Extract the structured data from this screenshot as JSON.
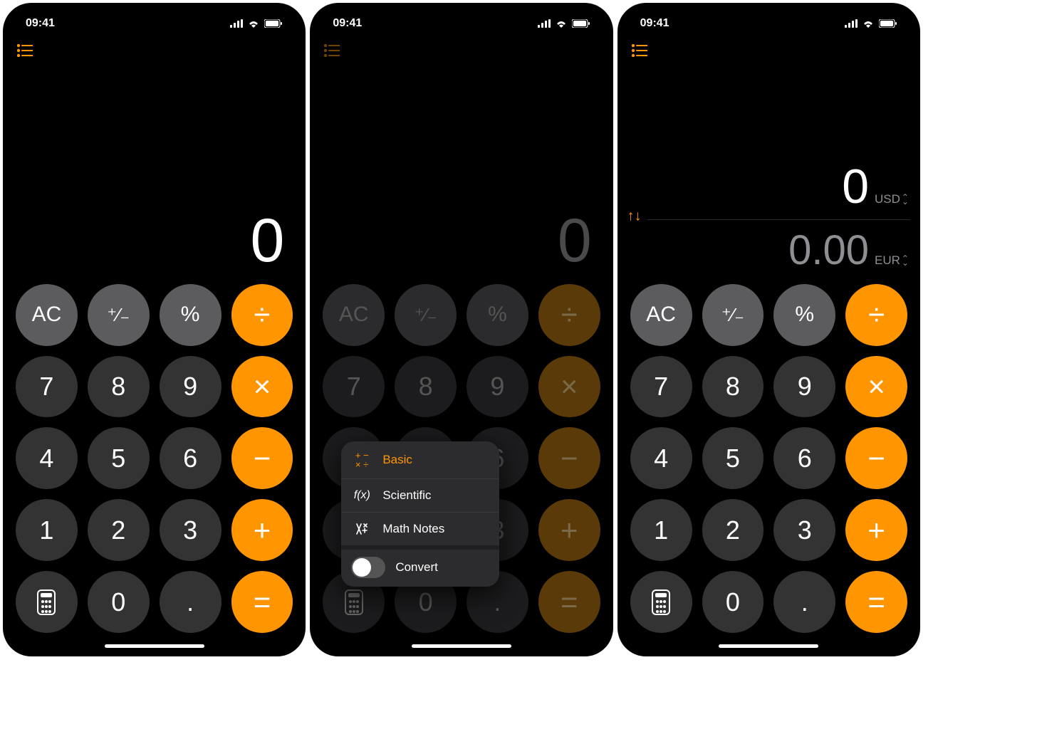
{
  "status": {
    "time": "09:41"
  },
  "screen1": {
    "display": "0"
  },
  "screen2": {
    "display": "0",
    "menu": {
      "basic": "Basic",
      "scientific": "Scientific",
      "mathnotes": "Math Notes",
      "convert": "Convert"
    }
  },
  "screen3": {
    "from_value": "0",
    "from_currency": "USD",
    "to_value": "0.00",
    "to_currency": "EUR"
  },
  "keys": {
    "ac": "AC",
    "plusminus": "⁺⁄₋",
    "percent": "%",
    "divide": "÷",
    "multiply": "×",
    "minus": "−",
    "plus": "+",
    "equals": "=",
    "decimal": ".",
    "d0": "0",
    "d1": "1",
    "d2": "2",
    "d3": "3",
    "d4": "4",
    "d5": "5",
    "d6": "6",
    "d7": "7",
    "d8": "8",
    "d9": "9"
  }
}
